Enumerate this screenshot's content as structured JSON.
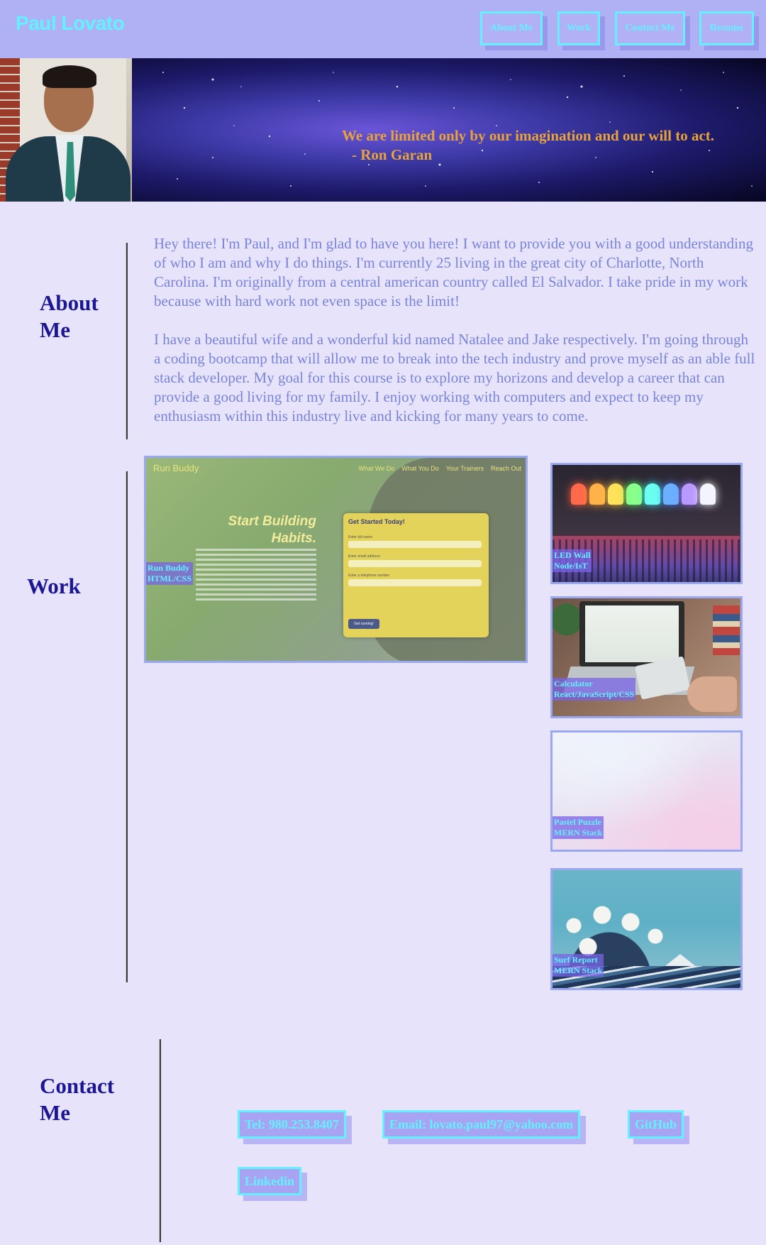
{
  "header": {
    "brand": "Paul Lovato",
    "nav": [
      {
        "label": "About Me"
      },
      {
        "label": "Work"
      },
      {
        "label": "Contact Me"
      },
      {
        "label": "Resume"
      }
    ]
  },
  "hero": {
    "quote": "We are limited only by our imagination and our will to act.",
    "author": "- Ron Garan"
  },
  "about": {
    "title": "About Me",
    "paragraphs": [
      "Hey there! I'm Paul, and I'm glad to have you here! I want to provide you with a good understanding of who I am and why I do things. I'm currently 25 living in the great city of Charlotte, North Carolina. I'm originally from a central american country called El Salvador. I take pride in my work because with hard work not even space is the limit!",
      "I have a beautiful wife and a wonderful kid named Natalee and Jake respectively. I'm going through a coding bootcamp that will allow me to break into the tech industry and prove myself as an able full stack developer. My goal for this course is to explore my horizons and develop a career that can provide a good living for my family. I enjoy working with computers and expect to keep my enthusiasm within this industry live and kicking for many years to come."
    ]
  },
  "work": {
    "title": "Work",
    "featured": {
      "name": "Run Buddy",
      "stack": "HTML/CSS",
      "preview": {
        "logo": "Run Buddy",
        "links": [
          "What We Do",
          "What You Do",
          "Your Trainers",
          "Reach Out"
        ],
        "headline": "Start Building Habits.",
        "form_title": "Get Started Today!",
        "field_labels": [
          "Enter full name:",
          "Enter email address:",
          "Enter a telephone number:"
        ],
        "submit": "Get running!"
      }
    },
    "projects": [
      {
        "name": "LED Wall",
        "stack": "Node/IsT"
      },
      {
        "name": "Calculator",
        "stack": "React/JavaScript/CSS"
      },
      {
        "name": "Pastel Puzzle",
        "stack": "MERN Stack"
      },
      {
        "name": "Surf Report",
        "stack": "MERN Stack"
      }
    ]
  },
  "contact": {
    "title": "Contact Me",
    "links": [
      {
        "label": "Tel: 980.253.8407"
      },
      {
        "label": "Email: lovato.paul97@yahoo.com"
      },
      {
        "label": "GitHub"
      },
      {
        "label": "Linkedin"
      }
    ]
  },
  "colors": {
    "accent_cyan": "#63f0ff",
    "header_bg": "#b0b1f5",
    "page_bg": "#e6e3fa",
    "heading": "#1b1794",
    "body_text": "#7a84d8",
    "quote": "#e8a33c"
  }
}
